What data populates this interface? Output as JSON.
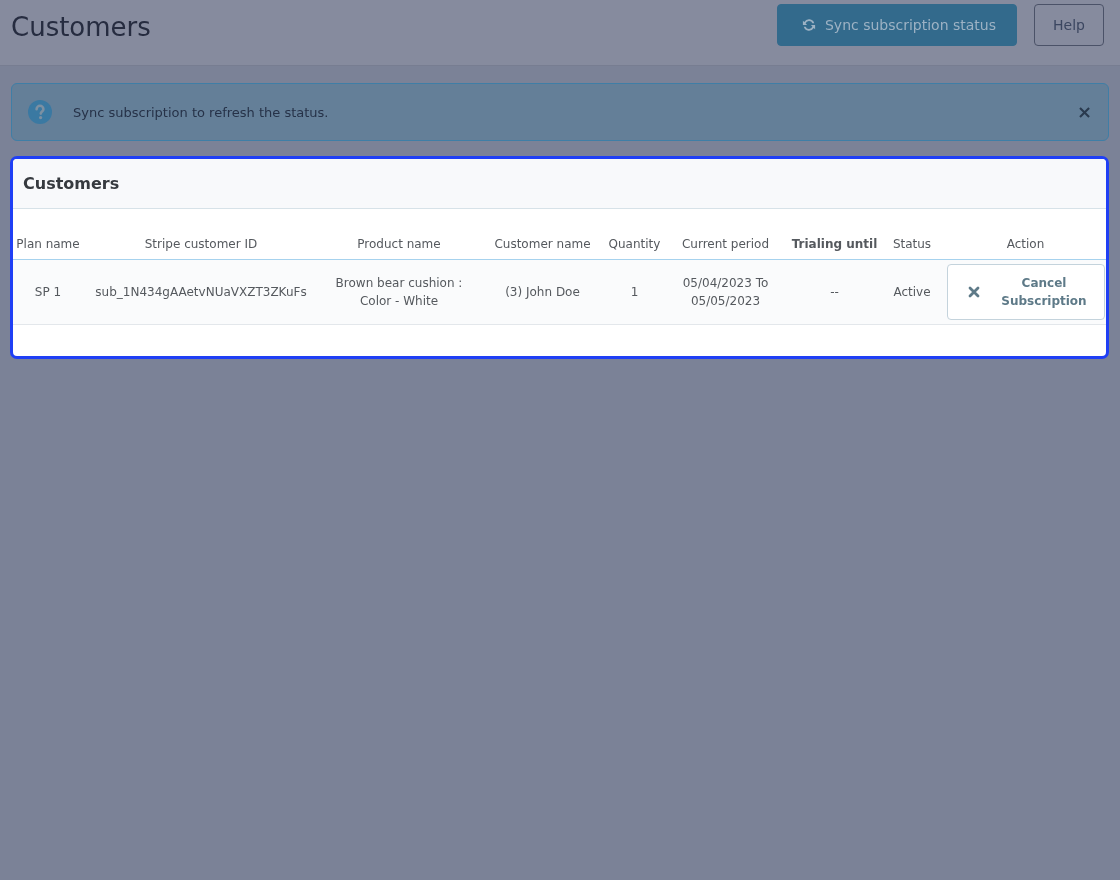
{
  "page": {
    "title": "Customers"
  },
  "toolbar": {
    "buttons": [
      {
        "label": "Sync subscription status",
        "kind": "primary"
      },
      {
        "label": "Help",
        "kind": "default"
      }
    ]
  },
  "alert": {
    "message": "Sync subscription to refresh the status.",
    "close": "×"
  },
  "panel": {
    "title": "Customers",
    "highlighted": true
  },
  "table": {
    "columns": [
      {
        "label": "Plan name",
        "bold": false
      },
      {
        "label": "Stripe customer ID",
        "bold": false
      },
      {
        "label": "Product name",
        "bold": false
      },
      {
        "label": "Customer name",
        "bold": false
      },
      {
        "label": "Quantity",
        "bold": false
      },
      {
        "label": "Current period",
        "bold": false
      },
      {
        "label": "Trialing until",
        "bold": true
      },
      {
        "label": "Status",
        "bold": false
      },
      {
        "label": "Action",
        "bold": false
      }
    ],
    "rows": [
      {
        "cells": [
          "SP 1",
          "sub_1N434gAAetvNUaVXZT3ZKuFs",
          "Brown bear cushion : Color - White",
          "(3) John Doe",
          "1",
          "05/04/2023 To 05/05/2023",
          "--",
          "Active"
        ],
        "action": {
          "label": "Cancel Subscription"
        }
      }
    ]
  }
}
